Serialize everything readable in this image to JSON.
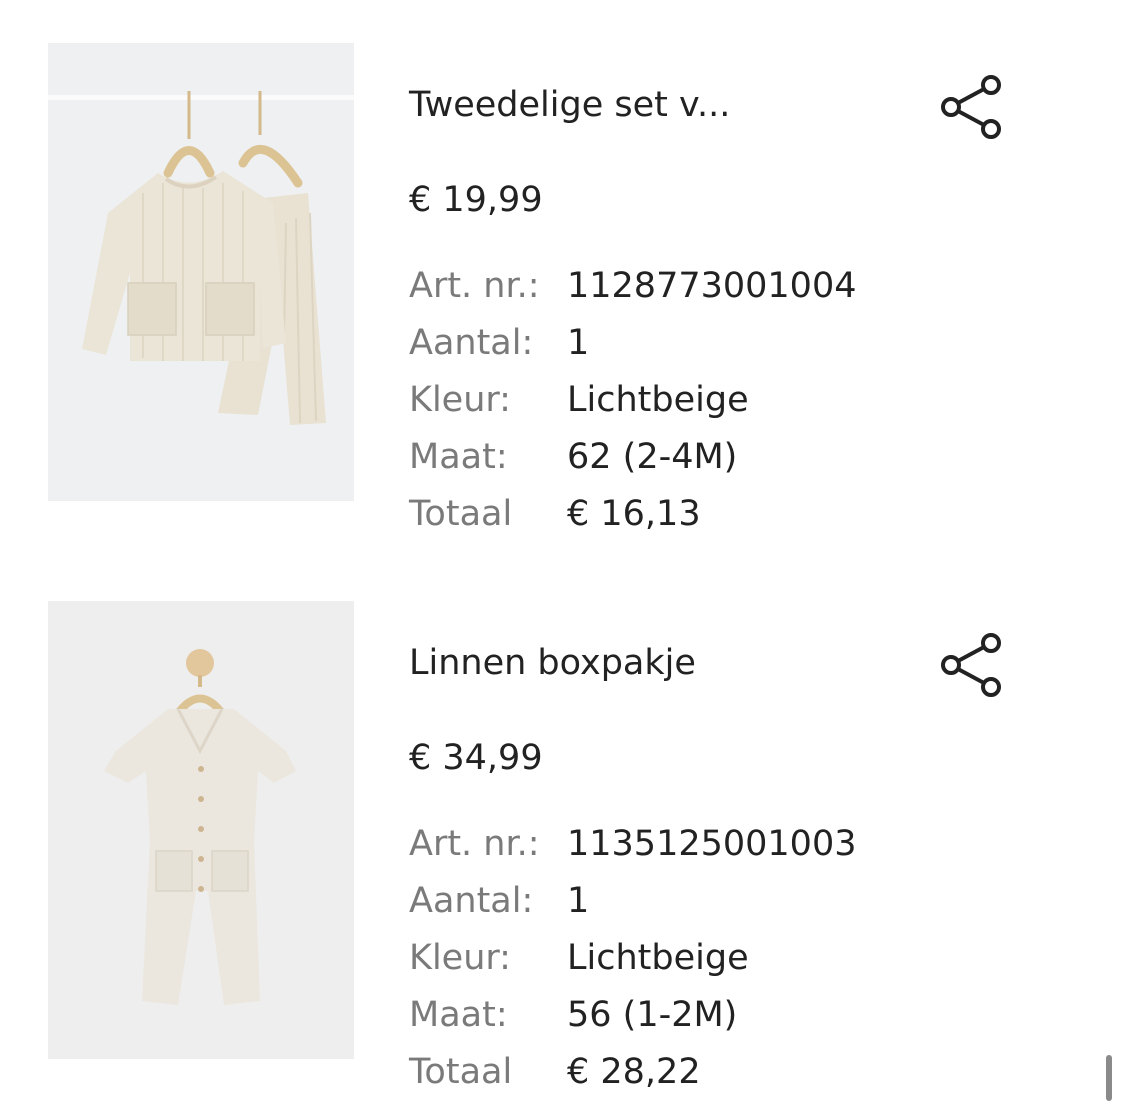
{
  "orders": [
    {
      "title": "Tweedelige set v...",
      "price": "€ 19,99",
      "details": [
        {
          "label": "Art. nr.:",
          "value": "1128773001004"
        },
        {
          "label": "Aantal:",
          "value": "1"
        },
        {
          "label": "Kleur:",
          "value": "Lichtbeige"
        },
        {
          "label": "Maat:",
          "value": "62 (2-4M)"
        },
        {
          "label": "Totaal",
          "value": "€ 16,13"
        }
      ],
      "share_icon": "share-icon"
    },
    {
      "title": "Linnen boxpakje",
      "price": "€ 34,99",
      "details": [
        {
          "label": "Art. nr.:",
          "value": "1135125001003"
        },
        {
          "label": "Aantal:",
          "value": "1"
        },
        {
          "label": "Kleur:",
          "value": "Lichtbeige"
        },
        {
          "label": "Maat:",
          "value": "56 (1-2M)"
        },
        {
          "label": "Totaal",
          "value": "€ 28,22"
        }
      ],
      "share_icon": "share-icon"
    }
  ],
  "colors": {
    "text": "#222222",
    "label": "#7a7a7a",
    "image_bg": "#eeeeee",
    "garment": "#e8e2d6"
  }
}
